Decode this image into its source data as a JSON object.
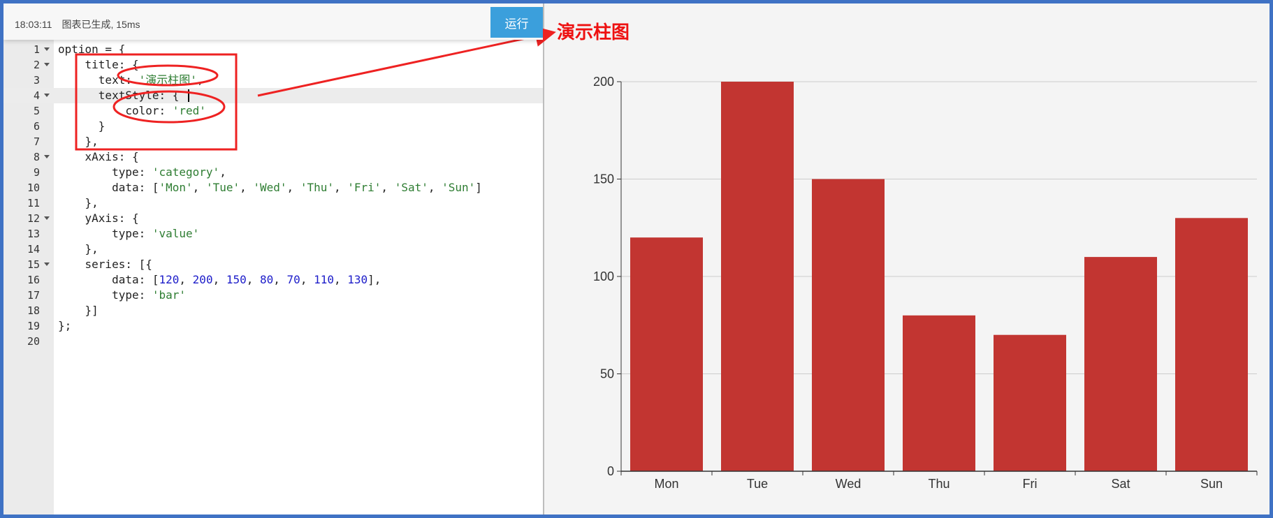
{
  "status": {
    "time": "18:03:11",
    "message": "图表已生成, 15ms"
  },
  "toolbar": {
    "run_label": "运行"
  },
  "editor": {
    "active_line": 4,
    "lines": [
      {
        "n": "1",
        "fold": true,
        "code": "option = {"
      },
      {
        "n": "2",
        "fold": true,
        "code": "    title: {"
      },
      {
        "n": "3",
        "fold": false,
        "code": "      text: '演示柱图',"
      },
      {
        "n": "4",
        "fold": true,
        "code": "      textStyle: {"
      },
      {
        "n": "5",
        "fold": false,
        "code": "          color: 'red'"
      },
      {
        "n": "6",
        "fold": false,
        "code": "      }"
      },
      {
        "n": "7",
        "fold": false,
        "code": "    },"
      },
      {
        "n": "8",
        "fold": true,
        "code": "    xAxis: {"
      },
      {
        "n": "9",
        "fold": false,
        "code": "        type: 'category',"
      },
      {
        "n": "10",
        "fold": false,
        "code": "        data: ['Mon', 'Tue', 'Wed', 'Thu', 'Fri', 'Sat', 'Sun']"
      },
      {
        "n": "11",
        "fold": false,
        "code": "    },"
      },
      {
        "n": "12",
        "fold": true,
        "code": "    yAxis: {"
      },
      {
        "n": "13",
        "fold": false,
        "code": "        type: 'value'"
      },
      {
        "n": "14",
        "fold": false,
        "code": "    },"
      },
      {
        "n": "15",
        "fold": true,
        "code": "    series: [{"
      },
      {
        "n": "16",
        "fold": false,
        "code": "        data: [120, 200, 150, 80, 70, 110, 130],"
      },
      {
        "n": "17",
        "fold": false,
        "code": "        type: 'bar'"
      },
      {
        "n": "18",
        "fold": false,
        "code": "    }]"
      },
      {
        "n": "19",
        "fold": false,
        "code": "};"
      },
      {
        "n": "20",
        "fold": false,
        "code": ""
      }
    ]
  },
  "annotation": {
    "title": "演示柱图",
    "color": "#ee1111"
  },
  "chart_data": {
    "type": "bar",
    "categories": [
      "Mon",
      "Tue",
      "Wed",
      "Thu",
      "Fri",
      "Sat",
      "Sun"
    ],
    "values": [
      120,
      200,
      150,
      80,
      70,
      110,
      130
    ],
    "yticks": [
      0,
      50,
      100,
      150,
      200
    ],
    "ylim": [
      0,
      200
    ],
    "bar_color": "#c23531",
    "grid": true
  }
}
